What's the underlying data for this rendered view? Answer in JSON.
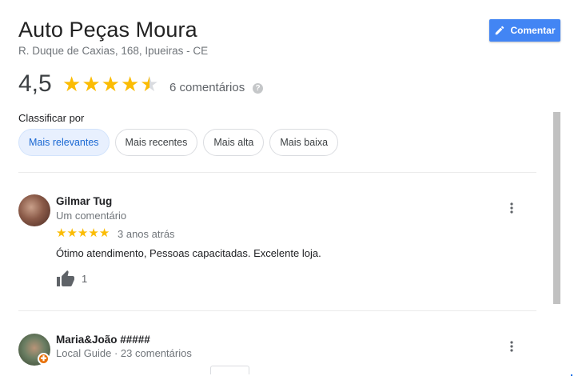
{
  "place": {
    "name": "Auto Peças Moura",
    "address": "R. Duque de Caxias, 168, Ipueiras - CE"
  },
  "header": {
    "comment_button_label": "Comentar"
  },
  "rating": {
    "value_label": "4,5",
    "value": 4.5,
    "max": 5,
    "count_label": "6 comentários",
    "help_glyph": "?"
  },
  "sort": {
    "label": "Classificar por",
    "options": [
      "Mais relevantes",
      "Mais recentes",
      "Mais alta",
      "Mais baixa"
    ],
    "selected": "Mais relevantes"
  },
  "reviews": [
    {
      "name": "Gilmar Tug",
      "meta": "Um comentário",
      "stars": 5,
      "time": "3 anos atrás",
      "text": "Ótimo atendimento, Pessoas capacitadas. Excelente loja.",
      "likes": "1"
    },
    {
      "name": "Maria&João #####",
      "meta": "Local Guide · 23 comentários",
      "badge_glyph": "✚"
    }
  ],
  "colors": {
    "star": "#fbbc04",
    "star_empty": "#dadce0",
    "accent": "#4285f4",
    "chip_active_bg": "#e8f0fe",
    "local_guide_badge": "#e8710a"
  },
  "icons": {
    "comment_button": "pencil-icon",
    "help": "help-icon",
    "like": "thumbs-up-icon",
    "menu": "more-vert-icon",
    "star": "star-icon"
  }
}
